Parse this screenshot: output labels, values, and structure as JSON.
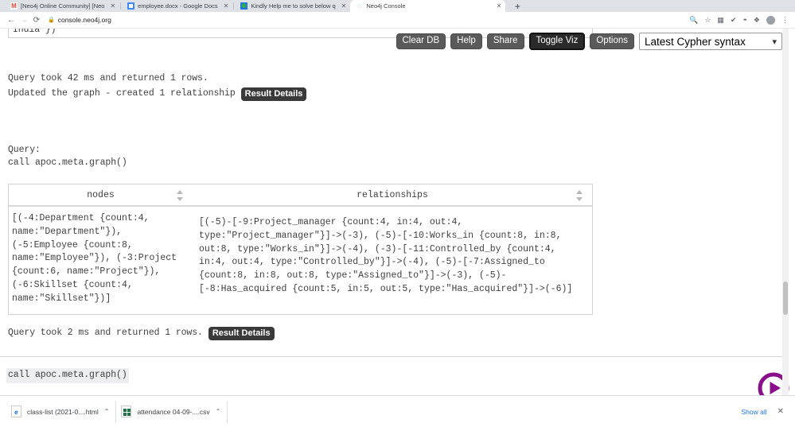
{
  "browser": {
    "tabs": [
      {
        "title": "[Neo4j Online Community] [Neo",
        "favicon": "gmail-icon",
        "active": false
      },
      {
        "title": "employee.docx - Google Docs",
        "favicon": "google-docs-icon",
        "active": false
      },
      {
        "title": "Kindly Help me to solve below q",
        "favicon": "community-icon",
        "active": false
      },
      {
        "title": "Neo4j Console",
        "favicon": "neo4j-icon",
        "active": true
      }
    ],
    "new_tab_label": "+",
    "close_label": "✕",
    "nav": {
      "back": "←",
      "forward": "→",
      "reload": "⟳"
    },
    "omnibox": {
      "lock": "🔒",
      "url": "console.neo4j.org"
    },
    "omnibox_actions": [
      "zoom-icon",
      "bookmark-star-icon",
      "extension-grid-icon",
      "checkmark-icon",
      "shield-icon",
      "puzzle-icon",
      "profile-avatar",
      "kebab-menu-icon"
    ]
  },
  "console": {
    "toolbar": {
      "clear_db": "Clear DB",
      "help": "Help",
      "share": "Share",
      "toggle_viz": "Toggle Viz",
      "options": "Options",
      "syntax_selected": "Latest Cypher syntax",
      "chevron": "⌄"
    },
    "clipped_previous": "India\"})",
    "previous_result": {
      "status": "Query took 42 ms and returned 1 rows.",
      "update": "Updated the graph - created 1 relationship",
      "result_details_label": "Result Details"
    },
    "query_block": {
      "label": "Query:",
      "text": "call apoc.meta.graph()"
    },
    "table": {
      "columns": [
        "nodes",
        "relationships"
      ],
      "rows": [
        {
          "nodes": "[(-4:Department {count:4, name:\"Department\"}), (-5:Employee {count:8, name:\"Employee\"}), (-3:Project {count:6, name:\"Project\"}), (-6:Skillset {count:4, name:\"Skillset\"})]",
          "relationships": "[(-5)-[-9:Project_manager {count:4, in:4, out:4, type:\"Project_manager\"}]->(-3), (-5)-[-10:Works_in {count:8, in:8, out:8, type:\"Works_in\"}]->(-4), (-3)-[-11:Controlled_by {count:4, in:4, out:4, type:\"Controlled_by\"}]->(-4), (-5)-[-7:Assigned_to {count:8, in:8, out:8, type:\"Assigned_to\"}]->(-3), (-5)-[-8:Has_acquired {count:5, in:5, out:5, type:\"Has_acquired\"}]->(-6)]"
        }
      ]
    },
    "current_result": {
      "status": "Query took 2 ms and returned 1 rows.",
      "result_details_label": "Result Details"
    },
    "editor": {
      "value": "call apoc.meta.graph()"
    },
    "run_button": "play-icon",
    "accent_color": "#8a0f8a"
  },
  "downloads": {
    "items": [
      {
        "name": "class-list (2021-0....html",
        "type": "html-file-icon",
        "caret": "⌃"
      },
      {
        "name": "attendance 04-09-....csv",
        "type": "csv-file-icon",
        "caret": "⌃"
      }
    ],
    "show_all": "Show all",
    "close": "✕"
  }
}
